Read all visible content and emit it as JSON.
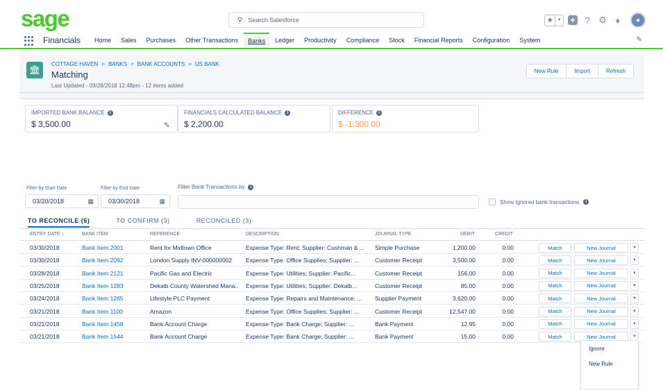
{
  "topbar": {
    "logo": "sage",
    "search_placeholder": "Search Salesforce"
  },
  "nav": {
    "app_name": "Financials",
    "items": [
      "Home",
      "Sales",
      "Purchases",
      "Other Transactions",
      "Banks",
      "Ledger",
      "Productivity",
      "Compliance",
      "Stock",
      "Financial Reports",
      "Configuration",
      "System"
    ],
    "active": "Banks"
  },
  "header": {
    "breadcrumbs": [
      "COTTAGE HAVEN",
      "BANKS",
      "BANK ACCOUNTS",
      "US BANK"
    ],
    "title": "Matching",
    "subtitle": "Last Updated - 03/28/2018 12:48pm - 12 items added",
    "buttons": [
      "New Rule",
      "Import",
      "Refresh"
    ]
  },
  "balances": [
    {
      "label": "IMPORTED BANK BALANCE",
      "value": "$ 3,500.00"
    },
    {
      "label": "FINANCIALS CALCULATED BALANCE",
      "value": "$ 2,200.00"
    },
    {
      "label": "DIFFERENCE",
      "value": "$ -1,300.00"
    }
  ],
  "colors": {
    "brand": "#4bc82d",
    "link": "#0070d2",
    "negative": "#ff9a3c"
  },
  "filters": {
    "start_label": "Filter by Start Date",
    "start_value": "03/20/2018",
    "end_label": "Filter by End Date",
    "end_value": "03/30/2018",
    "text_label": "Filter Bank Transactions by",
    "show_ignored": "Show Ignored bank transactions"
  },
  "tabs": [
    "TO RECONCILE (6)",
    "TO CONFIRM (3)",
    "RECONCILED (3)"
  ],
  "table": {
    "columns": [
      "ENTRY DATE",
      "BANK ITEM",
      "REFERENCE",
      "DESCRIPTION",
      "JOURNAL TYPE",
      "DEBIT",
      "CREDIT"
    ],
    "match_label": "Match",
    "journal_label": "New Journal",
    "rows": [
      {
        "date": "03/30/2018",
        "item": "Bank Item 2001",
        "ref": "Rent for Midtown Office",
        "desc": "Expense Type: Rent; Supplier: Cushman & ...",
        "type": "Simple Purchase",
        "debit": "1,200.00",
        "credit": "0.00"
      },
      {
        "date": "03/30/2018",
        "item": "Bank Item 2092",
        "ref": "London Supply INV-000000002",
        "desc": "Expense Type: Office Supplies; Supplier: ...",
        "type": "Customer Receipt",
        "debit": "3,500.00",
        "credit": "0.00"
      },
      {
        "date": "03/28/2018",
        "item": "Bank Item 2121",
        "ref": "Pacific Gas and Electric",
        "desc": "Expense Type: Utilities; Supplier: Pacific...",
        "type": "Customer Receipt",
        "debit": "156.00",
        "credit": "0.00"
      },
      {
        "date": "03/25/2018",
        "item": "Bank Item 1283",
        "ref": "Dekalb County Watershed Mana..",
        "desc": "Expense Type: Utilities; Supplier: Dekalb...",
        "type": "Customer Receipt",
        "debit": "85.00",
        "credit": "0.00"
      },
      {
        "date": "03/24/2018",
        "item": "Bank Item 1265",
        "ref": "Lifestyle PLC Payment",
        "desc": "Expense Type: Repairs and Maintenance; ...",
        "type": "Supplier Payment",
        "debit": "3,620.00",
        "credit": "0.00"
      },
      {
        "date": "03/21/2018",
        "item": "Bank Item 1100",
        "ref": "Amazon",
        "desc": "Expense Type: Office Supplies; Supplier: ...",
        "type": "Customer Receipt",
        "debit": "12,547.00",
        "credit": "0.00"
      },
      {
        "date": "03/21/2018",
        "item": "Bank Item 1458",
        "ref": "Bank Account Charge",
        "desc": "Expense Type: Bank Charge; Supplier: ...",
        "type": "Bank Payment",
        "debit": "12.95",
        "credit": "0.00"
      },
      {
        "date": "03/21/2018",
        "item": "Bank Item 1544",
        "ref": "Bank Account Charge",
        "desc": "Expense Type: Bank Charge; Supplier: ...",
        "type": "Bank Payment",
        "debit": "15.00",
        "credit": "0.00"
      }
    ]
  },
  "dropdown_menu": [
    "Ignore",
    "New Rule"
  ]
}
